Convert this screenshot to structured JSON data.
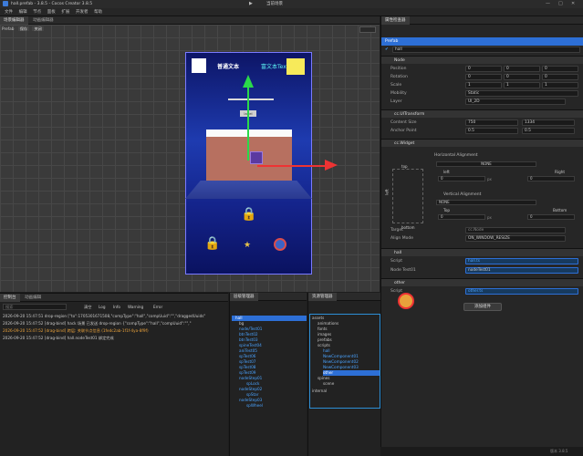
{
  "window": {
    "title": "hall.prefab - 3.8.5 - Cocos Creator 3.8.5",
    "preview_label": "当前场景"
  },
  "menubar": [
    "文件",
    "编辑",
    "节点",
    "面板",
    "扩展",
    "开发者",
    "帮助"
  ],
  "scene_panel": {
    "tabs": [
      "场景编辑器",
      "动画编辑器"
    ],
    "toolbar": [
      "Prefab",
      "保存",
      "关闭"
    ],
    "scene_texts": {
      "normal": "普通文本",
      "rich": "富文本Text",
      "label": "label"
    }
  },
  "inspector": {
    "tab": "属性检查器",
    "header": "Prefab",
    "node_name": "hall",
    "node_section": "Node",
    "position": {
      "label": "Position",
      "x": "0",
      "y": "0",
      "z": "0"
    },
    "rotation": {
      "label": "Rotation",
      "x": "0",
      "y": "0",
      "z": "0"
    },
    "scale": {
      "label": "Scale",
      "x": "1",
      "y": "1",
      "z": "1"
    },
    "mobility": {
      "label": "Mobility",
      "value": "Static"
    },
    "layer": {
      "label": "Layer",
      "value": "UI_2D"
    },
    "uitransform": {
      "title": "cc.UITransform",
      "content_size": {
        "label": "Content Size",
        "w": "750",
        "h": "1334"
      },
      "anchor": {
        "label": "Anchor Point",
        "x": "0.5",
        "y": "0.5"
      }
    },
    "widget": {
      "title": "cc.Widget",
      "horizontal_label": "Horizontal Alignment",
      "horizontal_value": "NONE",
      "top": "top",
      "left": "left",
      "right": "Right",
      "bottom": "bottom",
      "left_value": "0",
      "right_value": "0",
      "vertical_label": "Vertical Alignment",
      "vertical_value": "NONE",
      "top_label": "Top",
      "top_value": "0",
      "bottom_label": "Bottom",
      "bottom_value": "0",
      "unit": "px",
      "target_label": "Target",
      "target_value": "cc.Node",
      "align_mode_label": "Align Mode",
      "align_mode_value": "ON_WINDOW_RESIZE"
    },
    "hall": {
      "title": "hall",
      "script_label": "Script",
      "script_value": "hall.ts",
      "node_test_label": "Node Test01",
      "node_test_value": "nodeTest01"
    },
    "other": {
      "title": "other",
      "script_label": "Script",
      "script_value": "other.ts"
    },
    "add_component": "添加组件"
  },
  "console": {
    "tabs": [
      "控制台",
      "动画编辑"
    ],
    "filters": [
      "清空",
      "Log",
      "Info",
      "Warning",
      "Error"
    ],
    "search_placeholder": "搜索",
    "logs": [
      {
        "text": "2026-09-20 15:47:51 drop-region [\"to\":1705301671508,\"compType\":\"hall\",\"compUuid\":\"\",\"draggedUuids\"",
        "color": "#cfcfcf"
      },
      {
        "text": "2026-09-20 15:47:52 [drag-bind] hack 场景 已发送 drop-region {\"compType\":\"hall\",\"compUuid\":\"\",\"",
        "color": "#cfcfcf"
      },
      {
        "text": "2026-09-20 15:47:52 [drag-bind] 跨层: 关联节点信息 (1fedc2ab-1f1f-4ya-8f9f)",
        "color": "#e8a13b"
      },
      {
        "text": "2026-09-20 15:47:52 [drag-bind] hall.nodeTest01 绑定完成",
        "color": "#cfcfcf"
      }
    ]
  },
  "hierarchy": {
    "tab": "层级管理器",
    "root": "hall",
    "items": [
      "bg",
      "node/Test01",
      "btnTest02",
      "btnTest03",
      "spineTest04",
      "aniTest05",
      "spTest06",
      "spTest07",
      "spTest08",
      "spTest09",
      "nodeStep01",
      "spLock",
      "nodeStep02",
      "spStar",
      "nodeStep03",
      "spWheel"
    ]
  },
  "assets": {
    "tab": "资源管理器",
    "items": [
      "assets",
      "animations",
      "fonts",
      "images",
      "prefabs",
      "scripts",
      "hall",
      "NewComponent01",
      "NewComponent02",
      "NewComponent03",
      "other",
      "spines",
      "scene",
      "internal"
    ]
  },
  "status": {
    "version": "版本 3.8.5"
  },
  "colors": {
    "accent": "#4aa3ff",
    "highlight": "#2d6fd6",
    "warning": "#e8a13b"
  }
}
